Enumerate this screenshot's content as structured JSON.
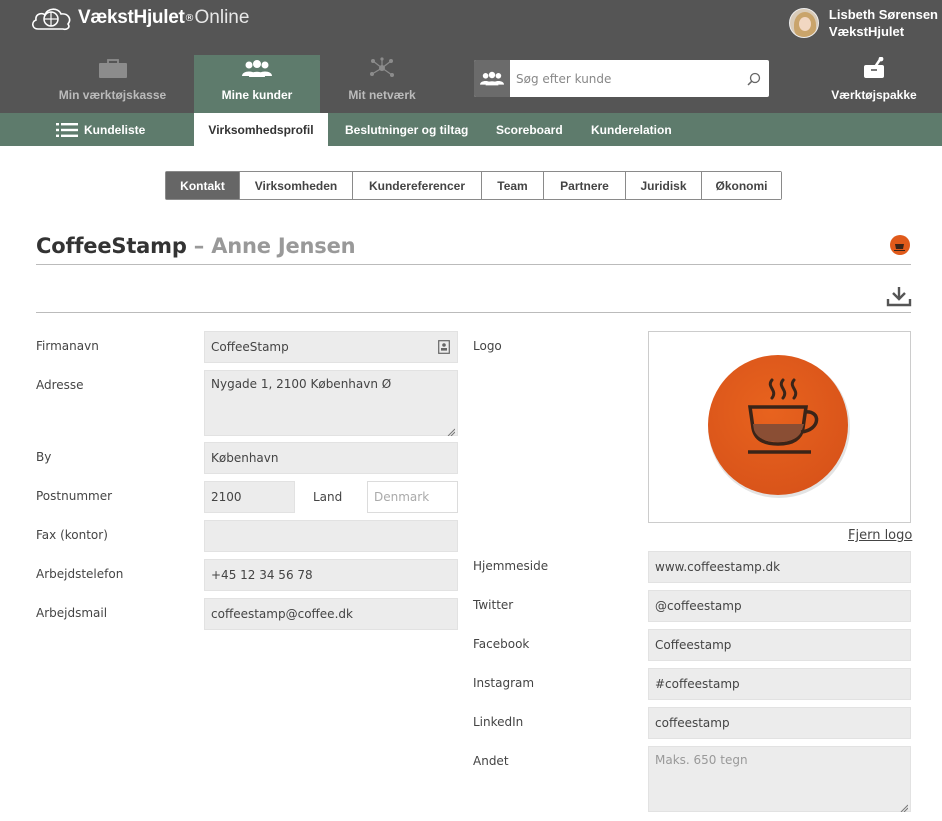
{
  "brand": {
    "name": "VækstHjulet",
    "reg": "®",
    "suffix": "Online"
  },
  "user": {
    "name": "Lisbeth Sørensen",
    "org": "VækstHjulet"
  },
  "mainnav": {
    "toolbox": "Min værktøjskasse",
    "customers": "Mine kunder",
    "network": "Mit netværk",
    "toolpackage": "Værktøjspakke"
  },
  "search": {
    "placeholder": "Søg efter kunde"
  },
  "subnav": {
    "customerlist": "Kundeliste",
    "profile": "Virksomhedsprofil",
    "decisions": "Beslutninger og tiltag",
    "scoreboard": "Scoreboard",
    "relation": "Kunderelation"
  },
  "tabs": [
    "Kontakt",
    "Virksomheden",
    "Kundereferencer",
    "Team",
    "Partnere",
    "Juridisk",
    "Økonomi"
  ],
  "heading": {
    "company": "CoffeeStamp",
    "separator": " – ",
    "person": "Anne Jensen"
  },
  "left_fields": {
    "firmanavn": {
      "label": "Firmanavn",
      "value": "CoffeeStamp"
    },
    "adresse": {
      "label": "Adresse",
      "value": "Nygade 1, 2100 København Ø"
    },
    "by": {
      "label": "By",
      "value": "København"
    },
    "postnummer": {
      "label": "Postnummer",
      "value": "2100"
    },
    "land": {
      "label": "Land",
      "placeholder": "Denmark"
    },
    "fax": {
      "label": "Fax (kontor)",
      "value": ""
    },
    "telefon": {
      "label": "Arbejdstelefon",
      "value": "+45 12 34 56 78"
    },
    "mail": {
      "label": "Arbejdsmail",
      "value": "coffeestamp@coffee.dk"
    }
  },
  "right_fields": {
    "logo": {
      "label": "Logo",
      "remove": "Fjern logo"
    },
    "hjemmeside": {
      "label": "Hjemmeside",
      "value": "www.coffeestamp.dk"
    },
    "twitter": {
      "label": "Twitter",
      "value": "@coffeestamp"
    },
    "facebook": {
      "label": "Facebook",
      "value": "Coffeestamp"
    },
    "instagram": {
      "label": "Instagram",
      "value": "#coffeestamp"
    },
    "linkedin": {
      "label": "LinkedIn",
      "value": "coffeestamp"
    },
    "andet": {
      "label": "Andet",
      "placeholder": "Maks. 650 tegn"
    }
  },
  "colors": {
    "topbar": "#555555",
    "accent_green": "#5e7b6c",
    "logo_orange": "#e05a1a"
  },
  "icons": {
    "toolbox": "briefcase-icon",
    "customers": "people-icon",
    "network": "network-icon",
    "toolpackage": "toolkit-icon",
    "search_left": "people-icon",
    "search_right": "magnifier-icon",
    "customerlist": "hamburger-icon",
    "download": "download-icon",
    "firmanavn": "contact-card-icon"
  }
}
